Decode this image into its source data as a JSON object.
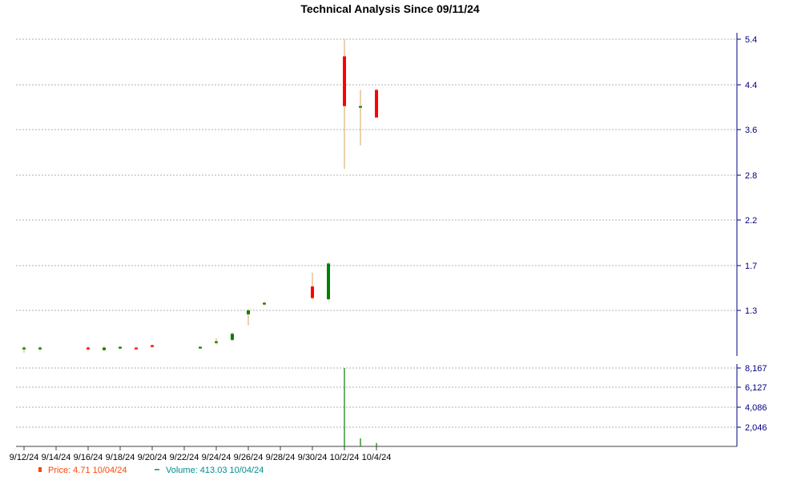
{
  "chart_data": {
    "type": "candlestick",
    "title": "Technical Analysis Since 09/11/24",
    "price_axis": {
      "ticks": [
        "1.3",
        "1.7",
        "2.2",
        "2.8",
        "3.6",
        "4.4",
        "5.4"
      ]
    },
    "volume_axis": {
      "ticks": [
        "2,046",
        "4,086",
        "6,127",
        "8,167"
      ]
    },
    "x_ticks": [
      "9/12/24",
      "9/14/24",
      "9/16/24",
      "9/18/24",
      "9/20/24",
      "9/22/24",
      "9/24/24",
      "9/26/24",
      "9/28/24",
      "9/30/24",
      "10/2/24",
      "10/4/24"
    ],
    "candles": [
      {
        "date": "9/12/24",
        "open": 1.03,
        "high": 1.05,
        "low": 1.01,
        "close": 1.04
      },
      {
        "date": "9/13/24",
        "open": 1.03,
        "high": 1.05,
        "low": 1.02,
        "close": 1.04
      },
      {
        "date": "9/16/24",
        "open": 1.04,
        "high": 1.05,
        "low": 1.02,
        "close": 1.03
      },
      {
        "date": "9/17/24",
        "open": 1.025,
        "high": 1.05,
        "low": 1.02,
        "close": 1.04
      },
      {
        "date": "9/18/24",
        "open": 1.04,
        "high": 1.05,
        "low": 1.03,
        "close": 1.045
      },
      {
        "date": "9/19/24",
        "open": 1.04,
        "high": 1.045,
        "low": 1.03,
        "close": 1.035
      },
      {
        "date": "9/20/24",
        "open": 1.055,
        "high": 1.06,
        "low": 1.04,
        "close": 1.05
      },
      {
        "date": "9/23/24",
        "open": 1.04,
        "high": 1.05,
        "low": 1.035,
        "close": 1.045
      },
      {
        "date": "9/24/24",
        "open": 1.07,
        "high": 1.1,
        "low": 1.06,
        "close": 1.08
      },
      {
        "date": "9/25/24",
        "open": 1.09,
        "high": 1.14,
        "low": 1.08,
        "close": 1.13
      },
      {
        "date": "9/26/24",
        "open": 1.27,
        "high": 1.31,
        "low": 1.19,
        "close": 1.3
      },
      {
        "date": "9/27/24",
        "open": 1.35,
        "high": 1.37,
        "low": 1.34,
        "close": 1.36
      },
      {
        "date": "9/30/24",
        "open": 1.5,
        "high": 1.63,
        "low": 1.39,
        "close": 1.4
      },
      {
        "date": "10/1/24",
        "open": 1.39,
        "high": 1.73,
        "low": 1.38,
        "close": 1.72
      },
      {
        "date": "10/2/24",
        "open": 5.0,
        "high": 5.4,
        "low": 2.9,
        "close": 4.0
      },
      {
        "date": "10/3/24",
        "open": 3.98,
        "high": 4.3,
        "low": 3.3,
        "close": 4.0
      },
      {
        "date": "10/4/24",
        "open": 4.3,
        "high": 4.32,
        "low": 3.8,
        "close": 3.8
      }
    ],
    "volume": [
      {
        "date": "10/2/24",
        "value": 8167
      },
      {
        "date": "10/3/24",
        "value": 900
      },
      {
        "date": "10/4/24",
        "value": 413.03
      }
    ],
    "colors": {
      "up": "#008000",
      "down": "#ff0000",
      "wick": "#d9a05b",
      "grid": "#b0b0b0",
      "axis": "#000080",
      "price_legend": "#ff4500",
      "volume_legend": "#008b8b",
      "volume_bar": "#008000"
    },
    "legend": [
      {
        "label": "Price: 4.71  10/04/24",
        "color": "#ff4500"
      },
      {
        "label": "Volume: 413.03  10/04/24",
        "color": "#008b8b"
      }
    ]
  }
}
